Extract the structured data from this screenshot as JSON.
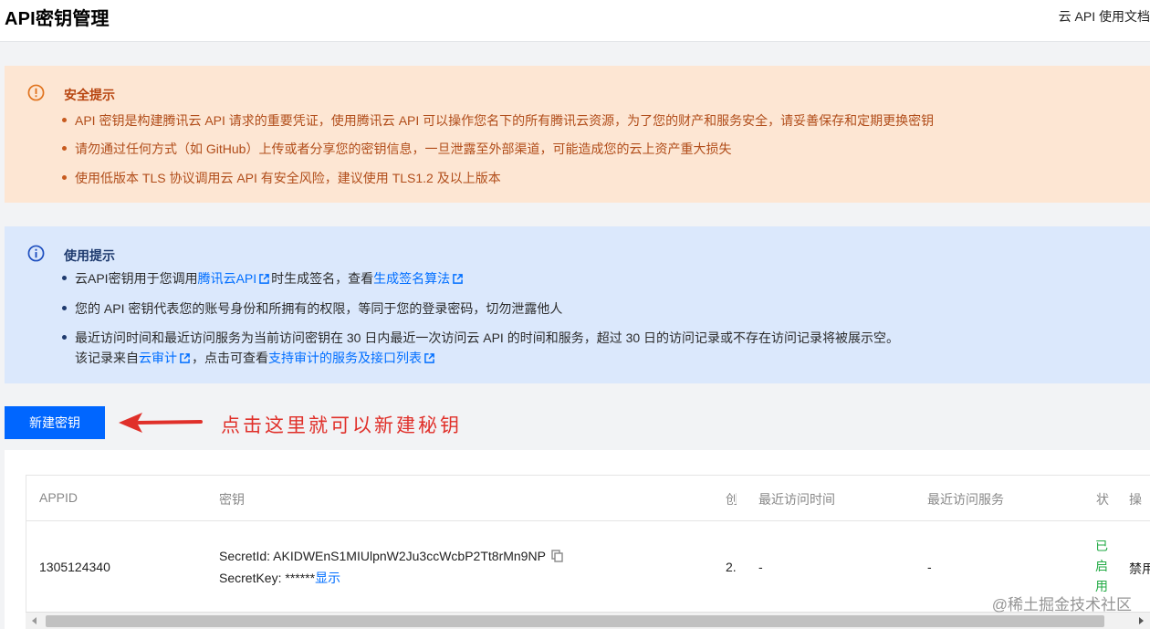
{
  "header": {
    "title": "API密钥管理",
    "doc_link": "云 API 使用文档"
  },
  "security_notice": {
    "title": "安全提示",
    "items": [
      "API 密钥是构建腾讯云 API 请求的重要凭证，使用腾讯云 API 可以操作您名下的所有腾讯云资源，为了您的财产和服务安全，请妥善保存和定期更换密钥",
      "请勿通过任何方式（如 GitHub）上传或者分享您的密钥信息，一旦泄露至外部渠道，可能造成您的云上资产重大损失",
      "使用低版本 TLS 协议调用云 API 有安全风险，建议使用 TLS1.2 及以上版本"
    ]
  },
  "usage_notice": {
    "title": "使用提示",
    "item1_prefix": "云API密钥用于您调用",
    "item1_link1": "腾讯云API",
    "item1_middle": "时生成签名，查看",
    "item1_link2": "生成签名算法",
    "item2": "您的 API 密钥代表您的账号身份和所拥有的权限，等同于您的登录密码，切勿泄露他人",
    "item3_line1": "最近访问时间和最近访问服务为当前访问密钥在 30 日内最近一次访问云 API 的时间和服务，超过 30 日的访问记录或不存在访问记录将被展示空。",
    "item3_line2_prefix": "该记录来自",
    "item3_link1": "云审计",
    "item3_line2_middle": "，点击可查看",
    "item3_link2": "支持审计的服务及接口列表"
  },
  "actions": {
    "create_key": "新建密钥"
  },
  "annotation": "点击这里就可以新建秘钥",
  "table": {
    "columns": [
      "APPID",
      "密钥",
      "创",
      "最近访问时间",
      "最近访问服务",
      "状",
      "操"
    ],
    "row": {
      "appid": "1305124340",
      "secret_id_label": "SecretId: ",
      "secret_id": "AKIDWEnS1MIUlpnW2Ju3ccWcbP2Tt8rMn9NP",
      "secret_key_label": "SecretKey: ",
      "secret_key": "******",
      "show_label": "显示",
      "created": "2.",
      "last_access_time": "-",
      "last_access_service": "-",
      "status": "已启用",
      "action": "禁用"
    }
  },
  "watermark": "@稀土掘金技术社区",
  "colors": {
    "primary": "#0066ff",
    "warning_bg": "#fde6d3",
    "info_bg": "#dbe8fc",
    "annotation": "#e0302a",
    "status_enabled": "#22aa44"
  }
}
